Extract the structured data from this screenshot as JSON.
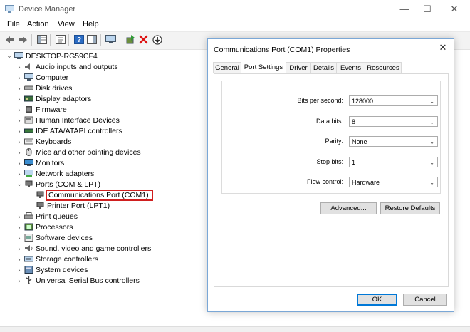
{
  "window": {
    "title": "Device Manager",
    "minimize_glyph": "—",
    "maximize_glyph": "☐",
    "close_glyph": "✕"
  },
  "menu": [
    "File",
    "Action",
    "View",
    "Help"
  ],
  "toolbar": {
    "icons": [
      "back-arrow-icon",
      "forward-arrow-icon",
      "show-hide-console-tree-icon",
      "properties-icon",
      "help-icon",
      "action-pane-icon",
      "monitor-icon",
      "update-driver-icon",
      "uninstall-device-icon",
      "scan-hardware-icon"
    ]
  },
  "tree": {
    "root": "DESKTOP-RG59CF4",
    "items": [
      {
        "label": "Audio inputs and outputs",
        "icon": "speaker-icon",
        "expanded": false
      },
      {
        "label": "Computer",
        "icon": "computer-icon",
        "expanded": false
      },
      {
        "label": "Disk drives",
        "icon": "disk-drive-icon",
        "expanded": false
      },
      {
        "label": "Display adaptors",
        "icon": "display-adapter-icon",
        "expanded": false
      },
      {
        "label": "Firmware",
        "icon": "firmware-icon",
        "expanded": false
      },
      {
        "label": "Human Interface Devices",
        "icon": "hid-icon",
        "expanded": false
      },
      {
        "label": "IDE ATA/ATAPI controllers",
        "icon": "ide-controller-icon",
        "expanded": false
      },
      {
        "label": "Keyboards",
        "icon": "keyboard-icon",
        "expanded": false
      },
      {
        "label": "Mice and other pointing devices",
        "icon": "mouse-icon",
        "expanded": false
      },
      {
        "label": "Monitors",
        "icon": "monitor-icon",
        "expanded": false
      },
      {
        "label": "Network adapters",
        "icon": "network-adapter-icon",
        "expanded": false
      },
      {
        "label": "Ports (COM & LPT)",
        "icon": "port-icon",
        "expanded": true,
        "children": [
          {
            "label": "Communications Port (COM1)",
            "icon": "port-icon",
            "selected": true
          },
          {
            "label": "Printer Port (LPT1)",
            "icon": "port-icon",
            "selected": false
          }
        ]
      },
      {
        "label": "Print queues",
        "icon": "printer-icon",
        "expanded": false
      },
      {
        "label": "Processors",
        "icon": "processor-icon",
        "expanded": false
      },
      {
        "label": "Software devices",
        "icon": "software-device-icon",
        "expanded": false
      },
      {
        "label": "Sound, video and game controllers",
        "icon": "sound-icon",
        "expanded": false
      },
      {
        "label": "Storage controllers",
        "icon": "storage-icon",
        "expanded": false
      },
      {
        "label": "System devices",
        "icon": "system-device-icon",
        "expanded": false
      },
      {
        "label": "Universal Serial Bus controllers",
        "icon": "usb-icon",
        "expanded": false
      }
    ]
  },
  "dialog": {
    "title": "Communications Port (COM1) Properties",
    "close_glyph": "✕",
    "tabs": [
      "General",
      "Port Settings",
      "Driver",
      "Details",
      "Events",
      "Resources"
    ],
    "active_tab": "Port Settings",
    "fields": [
      {
        "label": "Bits per second:",
        "value": "128000"
      },
      {
        "label": "Data bits:",
        "value": "8"
      },
      {
        "label": "Parity:",
        "value": "None"
      },
      {
        "label": "Stop bits:",
        "value": "1"
      },
      {
        "label": "Flow control:",
        "value": "Hardware"
      }
    ],
    "advanced_label": "Advanced...",
    "restore_label": "Restore Defaults",
    "ok_label": "OK",
    "cancel_label": "Cancel"
  },
  "colors": {
    "selection_outline": "#d01f1f",
    "dialog_border": "#7aa7d6",
    "default_button": "#0078d7"
  }
}
